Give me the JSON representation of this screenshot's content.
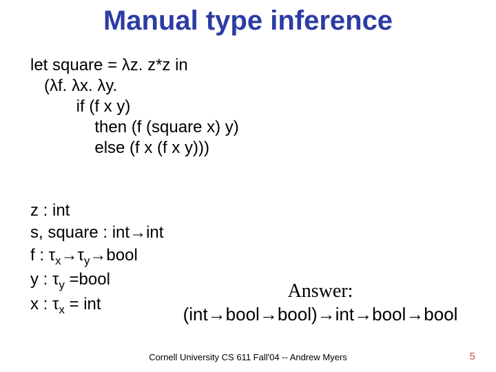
{
  "title": "Manual type inference",
  "code": {
    "l1": "let square = λz. z*z in",
    "l2": "   (λf. λx. λy.",
    "l3": "          if (f x y)",
    "l4": "              then (f (square x) y)",
    "l5": "              else (f x (f x y)))"
  },
  "types": {
    "l1": "z : int",
    "l2": "s, square : int→int",
    "l3_pref": "f : τ",
    "l3_sx": "x",
    "l3_mid": "→τ",
    "l3_sy": "y",
    "l3_suf": "→bool",
    "l4_pref": "y : τ",
    "l4_sy": "y",
    "l4_suf": " =bool",
    "l5_pref": "x : τ",
    "l5_sx": "x",
    "l5_suf": " = int"
  },
  "answer": {
    "label": "Answer:",
    "body": "(int→bool→bool)→int→bool→bool"
  },
  "footer": "Cornell University CS 611 Fall'04 -- Andrew Myers",
  "page": "5"
}
